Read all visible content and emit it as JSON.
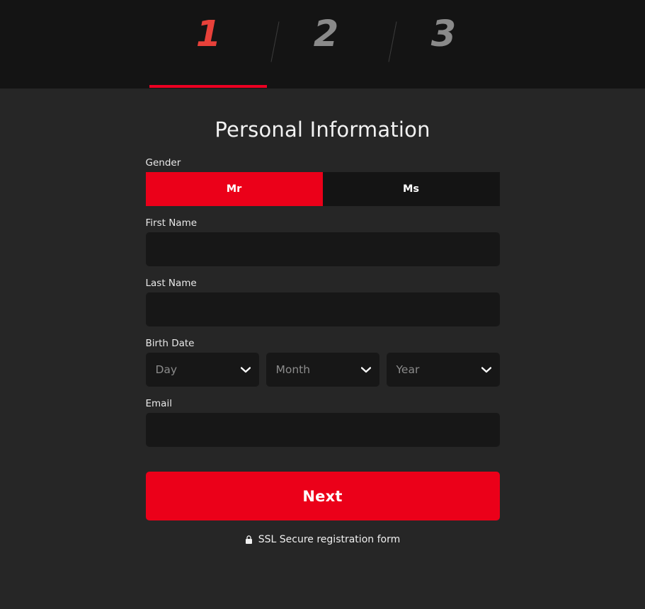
{
  "stepper": {
    "steps": [
      {
        "label": "1",
        "active": true
      },
      {
        "label": "2",
        "active": false
      },
      {
        "label": "3",
        "active": false
      }
    ],
    "active_color": "#e8413a",
    "inactive_color": "#8a8a8a",
    "underline_color": "#eb0022"
  },
  "form": {
    "title": "Personal Information",
    "gender": {
      "label": "Gender",
      "options": [
        {
          "label": "Mr",
          "selected": true
        },
        {
          "label": "Ms",
          "selected": false
        }
      ],
      "selected_color": "#eb0019"
    },
    "first_name": {
      "label": "First Name",
      "value": "",
      "placeholder": ""
    },
    "last_name": {
      "label": "Last Name",
      "value": "",
      "placeholder": ""
    },
    "birth_date": {
      "label": "Birth Date",
      "day": {
        "value": "Day"
      },
      "month": {
        "value": "Month"
      },
      "year": {
        "value": "Year"
      }
    },
    "email": {
      "label": "Email",
      "value": "",
      "placeholder": ""
    },
    "submit": {
      "label": "Next",
      "color": "#eb0019"
    },
    "ssl_note": {
      "icon": "lock-icon",
      "text": "SSL Secure registration form"
    }
  },
  "theme": {
    "header_bg": "#141414",
    "body_bg": "#262626",
    "input_bg": "#171717",
    "accent": "#eb0019"
  }
}
